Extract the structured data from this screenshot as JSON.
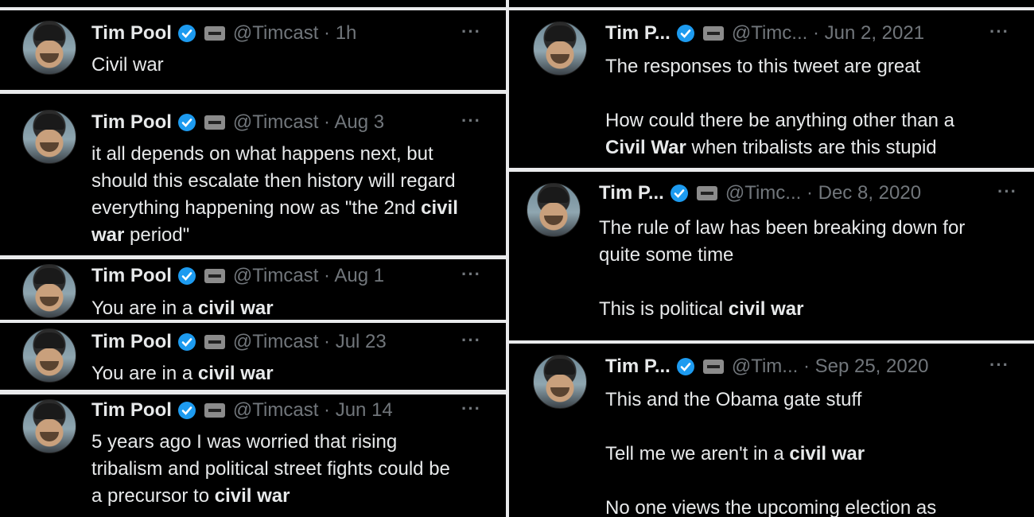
{
  "tweets": [
    {
      "name": "Tim Pool",
      "handle": "@Timcast",
      "time": "1h",
      "dot": "·",
      "segments": [
        {
          "t": "Civil war",
          "b": false
        }
      ]
    },
    {
      "name": "Tim Pool",
      "handle": "@Timcast",
      "time": "Aug 3",
      "dot": "·",
      "segments": [
        {
          "t": "it all depends on what happens next, but\nshould this escalate then history will regard\neverything happening now as \"the 2nd ",
          "b": false
        },
        {
          "t": "civil",
          "b": true
        },
        {
          "t": "\n",
          "b": false
        },
        {
          "t": "war",
          "b": true
        },
        {
          "t": " period\"",
          "b": false
        }
      ]
    },
    {
      "name": "Tim Pool",
      "handle": "@Timcast",
      "time": "Aug 1",
      "dot": "·",
      "segments": [
        {
          "t": "You are in a ",
          "b": false
        },
        {
          "t": "civil war",
          "b": true
        }
      ]
    },
    {
      "name": "Tim Pool",
      "handle": "@Timcast",
      "time": "Jul 23",
      "dot": "·",
      "segments": [
        {
          "t": "You are in a ",
          "b": false
        },
        {
          "t": "civil war",
          "b": true
        }
      ]
    },
    {
      "name": "Tim Pool",
      "handle": "@Timcast",
      "time": "Jun 14",
      "dot": "·",
      "segments": [
        {
          "t": "5 years ago I was worried that rising\ntribalism and political street fights could be\na precursor to ",
          "b": false
        },
        {
          "t": "civil war",
          "b": true
        }
      ]
    },
    {
      "name": "Tim P...",
      "handle": "@Timc...",
      "time": "Jun 2, 2021",
      "dot": "·",
      "segments": [
        {
          "t": "The responses to this tweet are great\n\nHow could there be anything other than a\n",
          "b": false
        },
        {
          "t": "Civil War",
          "b": true
        },
        {
          "t": " when tribalists are this stupid",
          "b": false
        }
      ]
    },
    {
      "name": "Tim P...",
      "handle": "@Timc...",
      "time": "Dec 8, 2020",
      "dot": "·",
      "segments": [
        {
          "t": "The rule of law has been breaking down for\nquite some time\n\nThis is political ",
          "b": false
        },
        {
          "t": "civil war",
          "b": true
        }
      ]
    },
    {
      "name": "Tim P...",
      "handle": "@Tim...",
      "time": "Sep 25, 2020",
      "dot": "·",
      "segments": [
        {
          "t": "This and the Obama gate stuff\n\nTell me we aren't in a ",
          "b": false
        },
        {
          "t": "civil war",
          "b": true
        },
        {
          "t": "\n\nNo one views the upcoming election as",
          "b": false
        }
      ]
    }
  ],
  "more_label": "···",
  "colors": {
    "bg": "#000000",
    "text": "#e7e9ea",
    "muted": "#71767b",
    "verified": "#1d9bf0"
  }
}
